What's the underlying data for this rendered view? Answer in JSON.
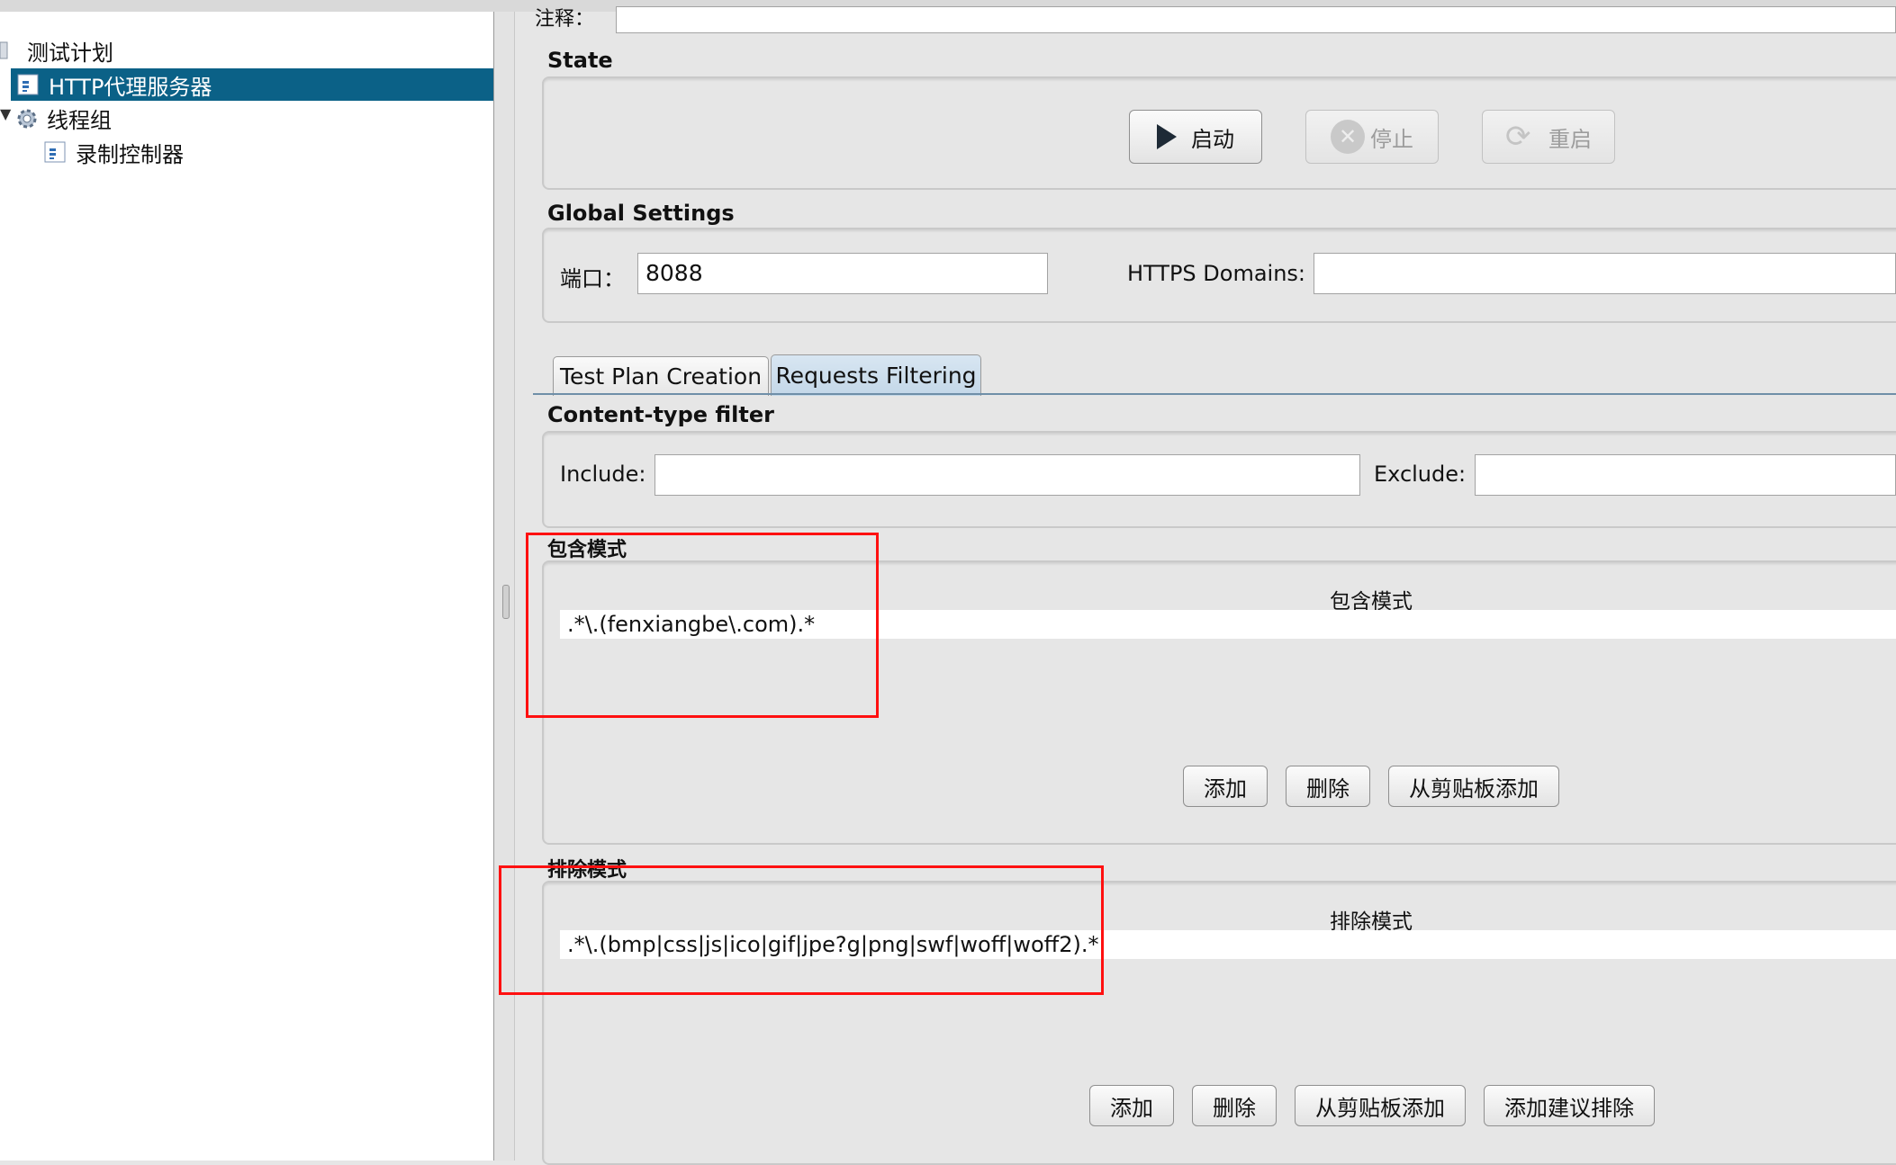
{
  "tree": {
    "items": [
      {
        "label": "测试计划"
      },
      {
        "label": "HTTP代理服务器"
      },
      {
        "label": "线程组"
      },
      {
        "label": "录制控制器"
      }
    ]
  },
  "comments": {
    "label": "注释："
  },
  "state": {
    "title": "State",
    "start_label": "启动",
    "stop_label": "停止",
    "restart_label": "重启"
  },
  "global_settings": {
    "title": "Global Settings",
    "port_label": "端口：",
    "port_value": "8088",
    "https_label": "HTTPS Domains:",
    "https_value": ""
  },
  "tabs": [
    {
      "label": "Test Plan Creation"
    },
    {
      "label": "Requests Filtering"
    }
  ],
  "content_type_filter": {
    "title": "Content-type filter",
    "include_label": "Include:",
    "include_value": "",
    "exclude_label": "Exclude:",
    "exclude_value": ""
  },
  "include_patterns": {
    "title": "包含模式",
    "column_header": "包含模式",
    "rows": [
      ".*\\.(fenxiangbe\\.com).*"
    ],
    "add_label": "添加",
    "delete_label": "删除",
    "paste_label": "从剪贴板添加"
  },
  "exclude_patterns": {
    "title": "排除模式",
    "column_header": "排除模式",
    "rows": [
      ".*\\.(bmp|css|js|ico|gif|jpe?g|png|swf|woff|woff2).*"
    ],
    "add_label": "添加",
    "delete_label": "删除",
    "paste_label": "从剪贴板添加",
    "suggest_label": "添加建议排除"
  },
  "colors": {
    "selection": "#0b6187",
    "annotation": "#ff1010"
  }
}
